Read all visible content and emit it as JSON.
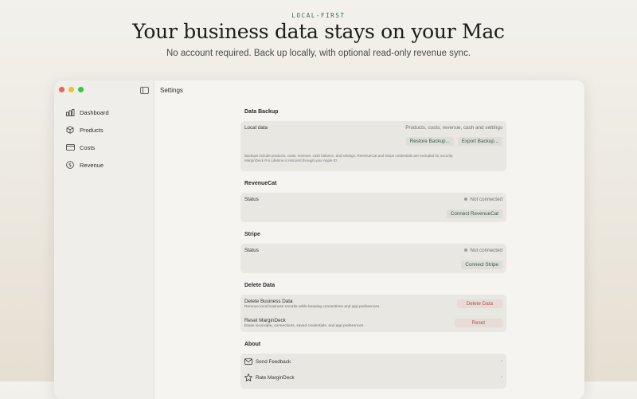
{
  "hero": {
    "eyebrow": "LOCAL-FIRST",
    "headline": "Your business data stays on your Mac",
    "subhead": "No account required. Back up locally, with optional read-only revenue sync."
  },
  "window": {
    "title": "Settings"
  },
  "sidebar": {
    "items": [
      {
        "label": "Dashboard",
        "icon": "chart-bars-icon"
      },
      {
        "label": "Products",
        "icon": "cube-icon"
      },
      {
        "label": "Costs",
        "icon": "credit-card-icon"
      },
      {
        "label": "Revenue",
        "icon": "dollar-circle-icon"
      }
    ]
  },
  "backup": {
    "title": "Data Backup",
    "label": "Local data",
    "summary": "Products, costs, revenue, cash and settings",
    "restore_label": "Restore Backup...",
    "export_label": "Export Backup...",
    "note_line1": "Backups include products, costs, revenue, cash balance, and settings. RevenueCat and Stripe credentials are excluded for security.",
    "note_line2": "MarginDeck Pro Lifetime is restored through your Apple ID."
  },
  "revenuecat": {
    "title": "RevenueCat",
    "status_label": "Status",
    "status_value": "Not connected",
    "connect_label": "Connect RevenueCat"
  },
  "stripe": {
    "title": "Stripe",
    "status_label": "Status",
    "status_value": "Not connected",
    "connect_label": "Connect Stripe"
  },
  "delete": {
    "title": "Delete Data",
    "business_title": "Delete Business Data",
    "business_desc": "Remove local business records while keeping connections and app preferences.",
    "business_button": "Delete Data",
    "reset_title": "Reset MarginDeck",
    "reset_desc": "Erase local data, connections, saved credentials, and app preferences.",
    "reset_button": "Reset"
  },
  "about": {
    "title": "About",
    "items": [
      {
        "label": "Send Feedback",
        "icon": "envelope-icon"
      },
      {
        "label": "Rate MarginDeck",
        "icon": "star-icon"
      }
    ]
  }
}
